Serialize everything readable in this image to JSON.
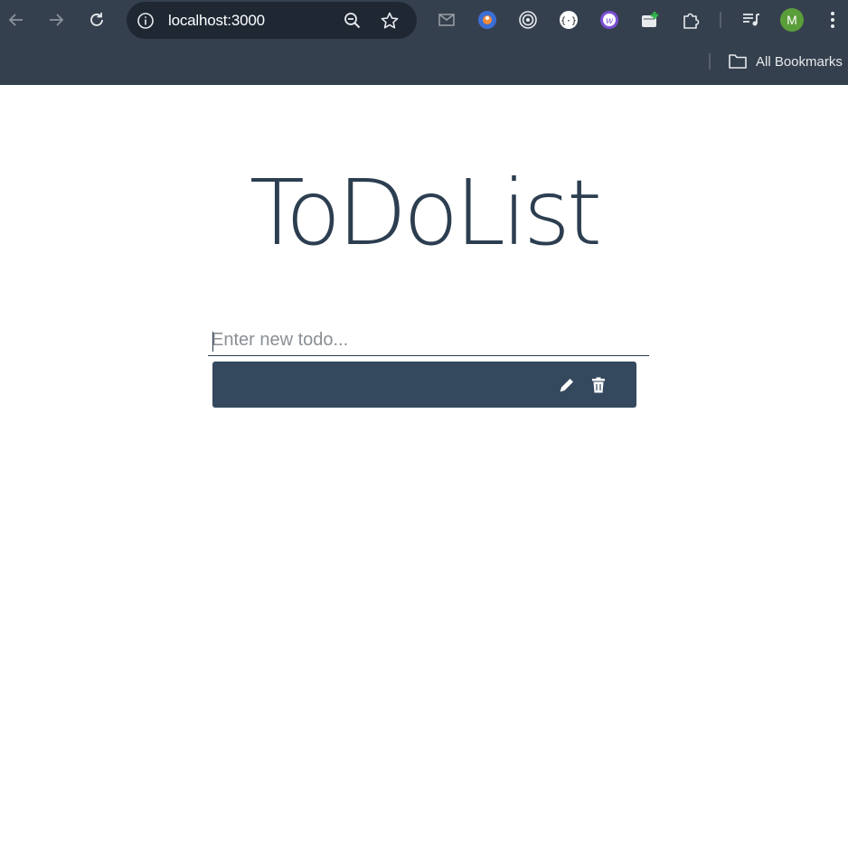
{
  "browser": {
    "url": "localhost:3000",
    "profile_initial": "M",
    "bookmarks_label": "All Bookmarks",
    "extensions": [
      "mail-icon",
      "orange-bird-extension-icon",
      "target-extension-icon",
      "code-braces-extension-icon",
      "purple-w-extension-icon",
      "green-plus-extension-icon",
      "puzzle-extensions-icon",
      "media-playlist-icon"
    ]
  },
  "app": {
    "title": "ToDoList",
    "input": {
      "placeholder": "Enter new todo...",
      "value": ""
    },
    "todos": [
      {
        "text": "",
        "edit_icon": "pencil-icon",
        "delete_icon": "trash-icon"
      }
    ]
  },
  "colors": {
    "chrome_bg": "#35404e",
    "omnibox_bg": "#1f2733",
    "title_color": "#2c3e50",
    "todo_item_bg": "#34495e"
  }
}
